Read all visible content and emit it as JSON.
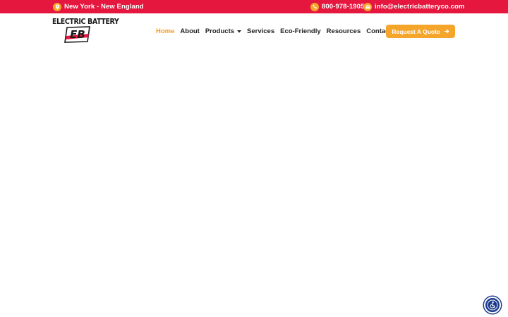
{
  "topbar": {
    "location": "New York - New England",
    "phone": "800-978-1905",
    "email": "info@electricbatteryco.com",
    "background_color": "#e5173f",
    "icon_color": "#f4a52a",
    "location_icon": "map-pin-icon",
    "phone_icon": "phone-icon",
    "email_icon": "envelope-icon"
  },
  "logo": {
    "wordmark": "ELECTRIC BATTERY",
    "monogram": "EB"
  },
  "nav": {
    "items": [
      {
        "label": "Home",
        "active": true
      },
      {
        "label": "About",
        "active": false
      },
      {
        "label": "Products",
        "active": false,
        "has_dropdown": true
      },
      {
        "label": "Services",
        "active": false
      },
      {
        "label": "Eco-Friendly",
        "active": false
      },
      {
        "label": "Resources",
        "active": false
      },
      {
        "label": "Contact",
        "active": false
      }
    ],
    "active_color": "#f29b1f"
  },
  "cta": {
    "label": "Request A Quote",
    "color": "#f4a52a",
    "icon": "arrow-right-icon"
  },
  "accessibility": {
    "icon": "accessibility-icon",
    "color": "#1b3a8c"
  }
}
